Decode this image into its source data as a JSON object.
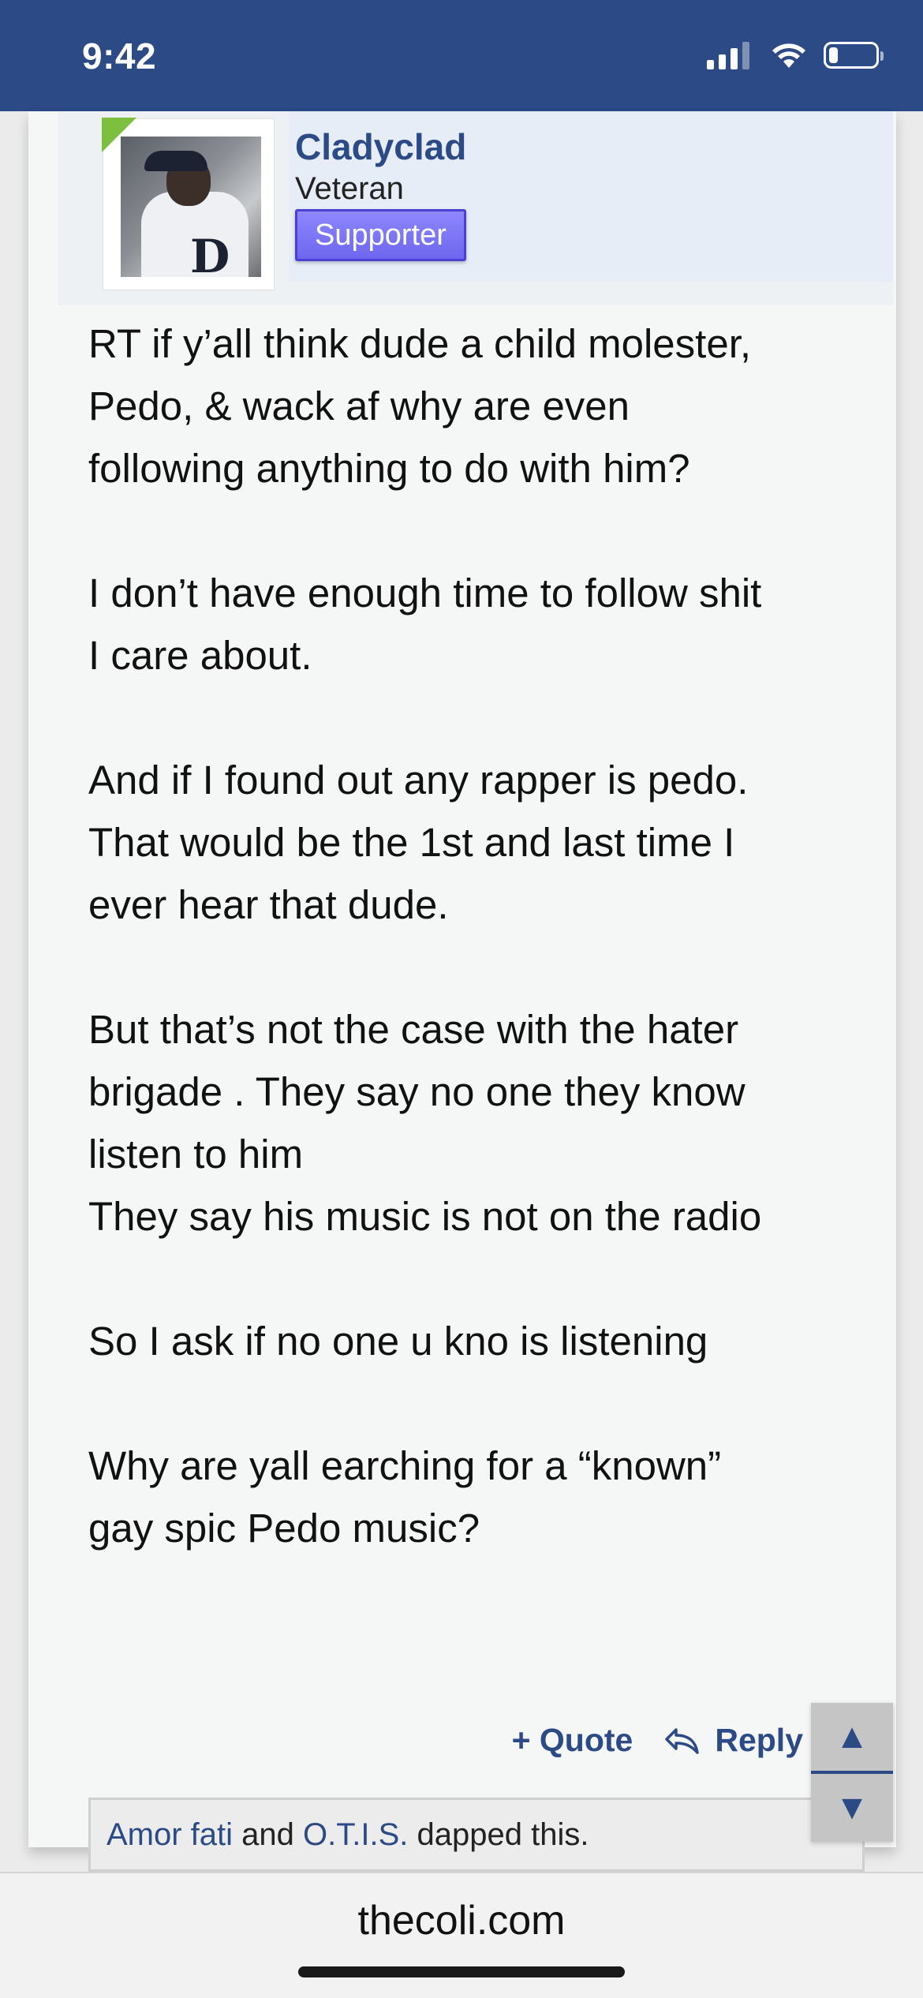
{
  "status_bar": {
    "time": "9:42",
    "battery_level_percent": 20
  },
  "post": {
    "author": {
      "username": "Cladyclad",
      "title": "Veteran",
      "badge": "Supporter"
    },
    "body": {
      "p1_l1": "RT if y’all think dude a child molester,",
      "p1_l2": "Pedo, & wack af why are even",
      "p1_l3": "following anything to do with him?",
      "p2_l1": "I don’t have enough time to follow shit",
      "p2_l2": "I care about.",
      "p3_l1": "And if I found out any rapper is pedo.",
      "p3_l2": "That would be the 1st and last time I",
      "p3_l3": "ever hear that dude.",
      "p4_l1": "But that’s not the case with the hater",
      "p4_l2": "brigade . They say no one they know",
      "p4_l3": "listen to him",
      "p4_l4": "They say his music is not on the radio",
      "p5_l1": "So I ask if no one u kno is listening",
      "p6_l1": "Why are yall earching for a “known”",
      "p6_l2": "gay spic Pedo music?"
    },
    "actions": {
      "quote_label": "+ Quote",
      "reply_label": "Reply"
    },
    "dapped": {
      "user1": "Amor fati",
      "connector": " and ",
      "user2": "O.T.I.S.",
      "suffix": " dapped this."
    }
  },
  "scroll_controls": {
    "up_icon": "up-triangle-icon",
    "down_icon": "down-triangle-icon"
  },
  "browser": {
    "domain": "thecoli.com"
  },
  "colors": {
    "header": "#2b4a86",
    "link": "#2b4a86",
    "badge": "#7a72f5",
    "online_indicator": "#7fbf3f"
  }
}
